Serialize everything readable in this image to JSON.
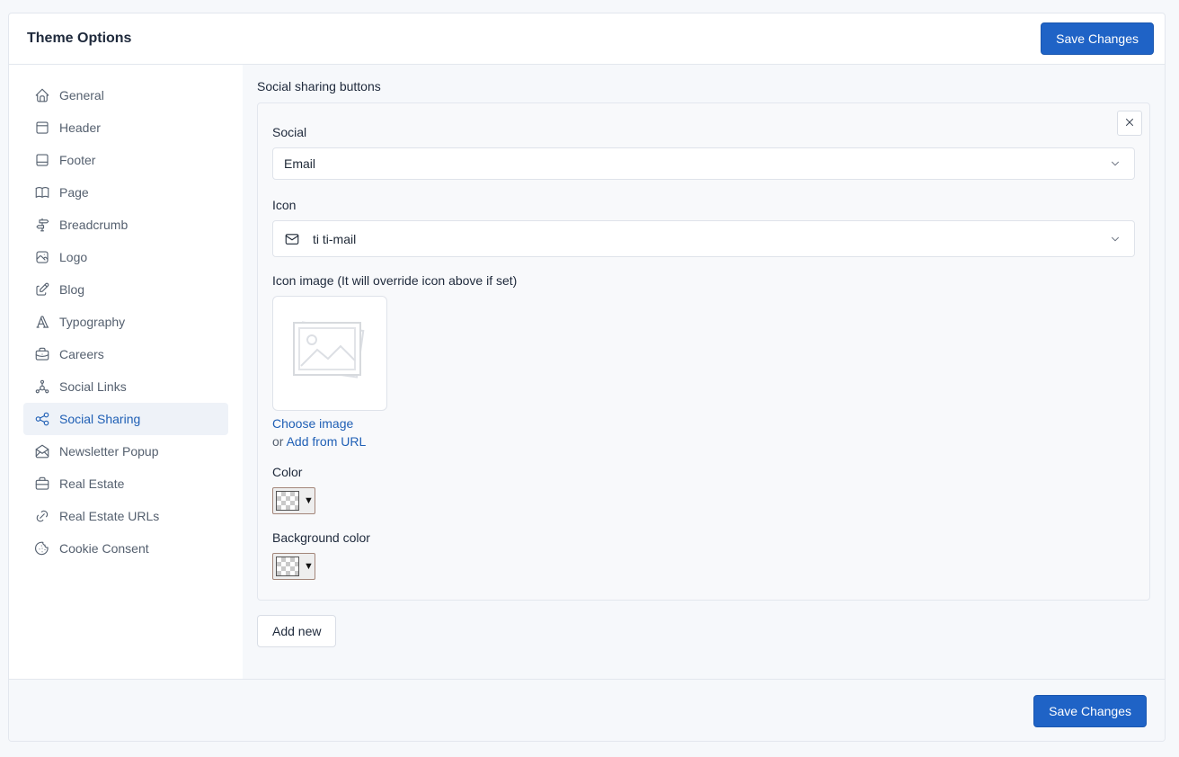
{
  "header": {
    "title": "Theme Options",
    "save_label": "Save Changes"
  },
  "sidebar": {
    "items": [
      {
        "label": "General",
        "icon": "home-icon"
      },
      {
        "label": "Header",
        "icon": "layout-navbar-icon"
      },
      {
        "label": "Footer",
        "icon": "layout-bottombar-icon"
      },
      {
        "label": "Page",
        "icon": "book-icon"
      },
      {
        "label": "Breadcrumb",
        "icon": "directions-icon"
      },
      {
        "label": "Logo",
        "icon": "photo-icon"
      },
      {
        "label": "Blog",
        "icon": "edit-icon"
      },
      {
        "label": "Typography",
        "icon": "typography-icon"
      },
      {
        "label": "Careers",
        "icon": "briefcase-icon"
      },
      {
        "label": "Social Links",
        "icon": "social-icon"
      },
      {
        "label": "Social Sharing",
        "icon": "share-icon",
        "active": true
      },
      {
        "label": "Newsletter Popup",
        "icon": "mail-opened-icon"
      },
      {
        "label": "Real Estate",
        "icon": "briefcase-2-icon"
      },
      {
        "label": "Real Estate URLs",
        "icon": "link-icon"
      },
      {
        "label": "Cookie Consent",
        "icon": "cookie-icon"
      }
    ]
  },
  "main": {
    "section_label": "Social sharing buttons",
    "item": {
      "social_label": "Social",
      "social_value": "Email",
      "icon_label": "Icon",
      "icon_value": "ti ti-mail",
      "icon_image_label": "Icon image (It will override icon above if set)",
      "choose_image": "Choose image",
      "or_text": "or",
      "add_from_url": "Add from URL",
      "color_label": "Color",
      "background_color_label": "Background color"
    },
    "add_new_label": "Add new"
  },
  "footer": {
    "save_label": "Save Changes"
  },
  "colors": {
    "accent": "#1f63c6",
    "active_bg": "#eef2f8",
    "link": "#1f5fb5"
  }
}
